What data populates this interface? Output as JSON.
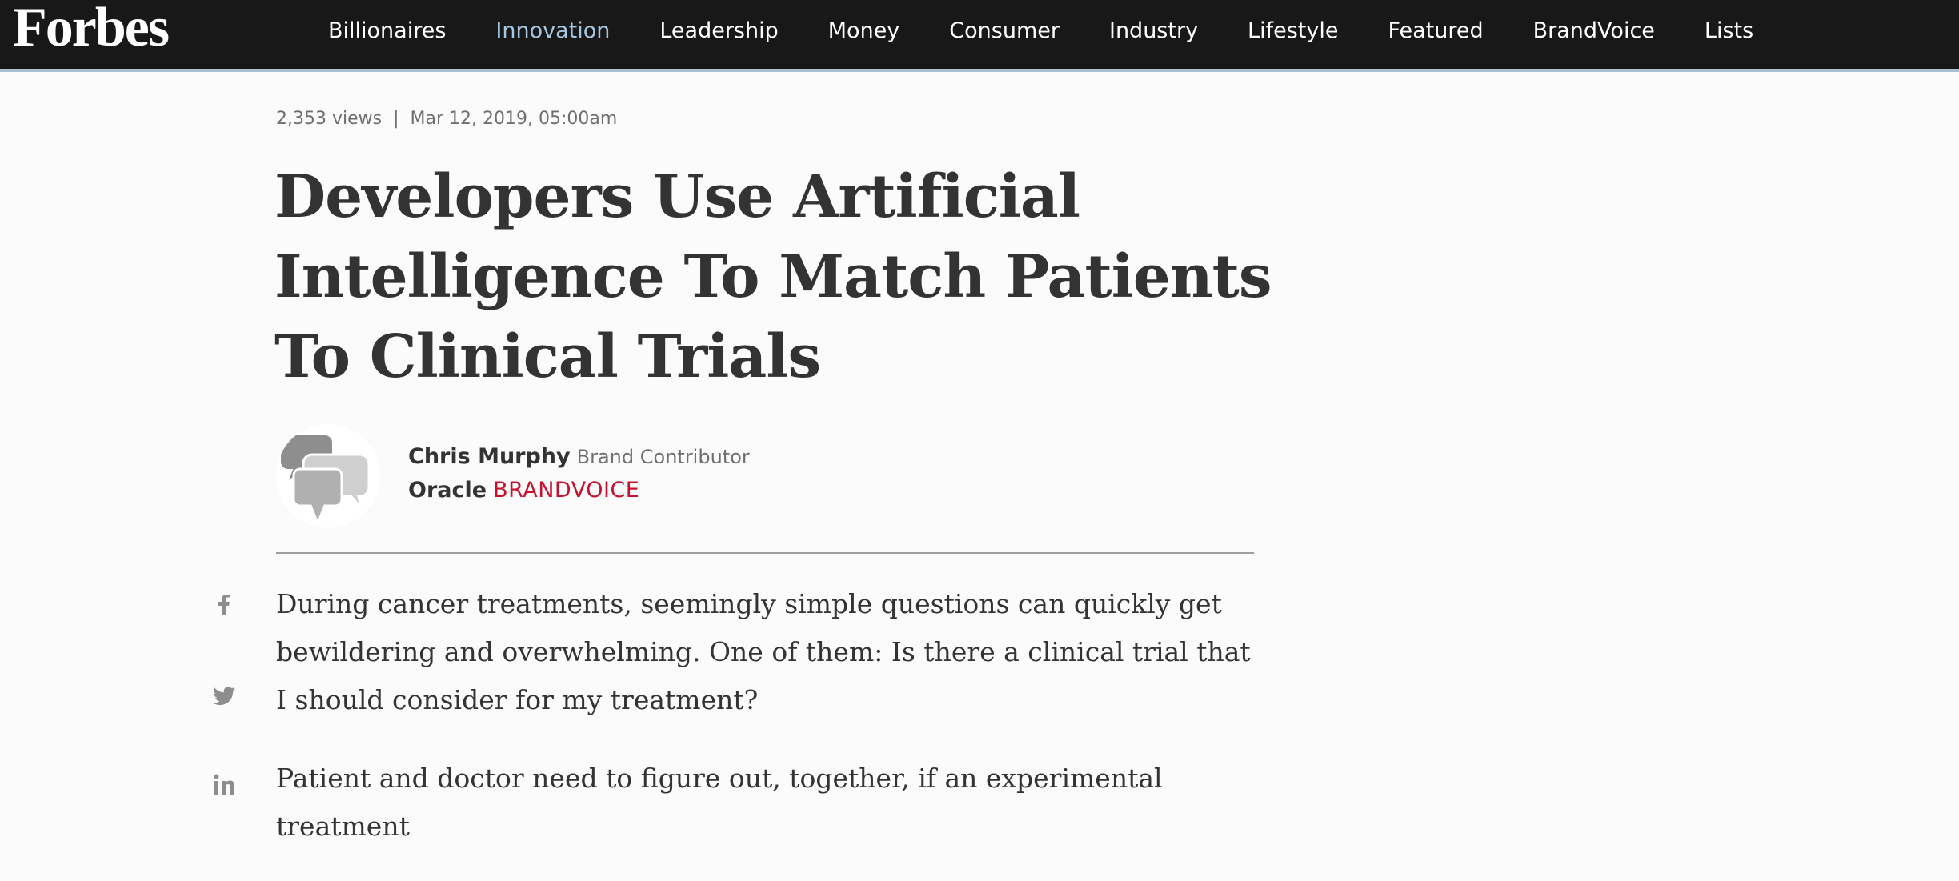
{
  "header": {
    "logo": "Forbes",
    "nav": [
      {
        "label": "Billionaires",
        "active": false
      },
      {
        "label": "Innovation",
        "active": true
      },
      {
        "label": "Leadership",
        "active": false
      },
      {
        "label": "Money",
        "active": false
      },
      {
        "label": "Consumer",
        "active": false
      },
      {
        "label": "Industry",
        "active": false
      },
      {
        "label": "Lifestyle",
        "active": false
      },
      {
        "label": "Featured",
        "active": false
      },
      {
        "label": "BrandVoice",
        "active": false
      },
      {
        "label": "Lists",
        "active": false
      }
    ]
  },
  "article": {
    "views": "2,353 views",
    "separator": "|",
    "date": "Mar 12, 2019, 05:00am",
    "title": "Developers Use Artificial Intelligence To Match Patients To Clinical Trials",
    "author": {
      "name": "Chris Murphy",
      "role": "Brand Contributor",
      "brand": "Oracle",
      "brand_tag": "BRANDVOICE",
      "avatar_icon": "chat-bubbles-icon"
    },
    "paragraphs": [
      "During cancer treatments, seemingly simple questions can quickly get bewildering and overwhelming. One of them: Is there a clinical trial that I should consider for my treatment?",
      "Patient and doctor need to figure out, together, if an experimental treatment"
    ]
  },
  "share": {
    "icons": [
      "facebook-icon",
      "twitter-icon",
      "linkedin-icon"
    ]
  },
  "colors": {
    "topbar": "#181818",
    "active_nav": "#a6c6e2",
    "brandvoice": "#c8102e",
    "text": "#333333"
  }
}
